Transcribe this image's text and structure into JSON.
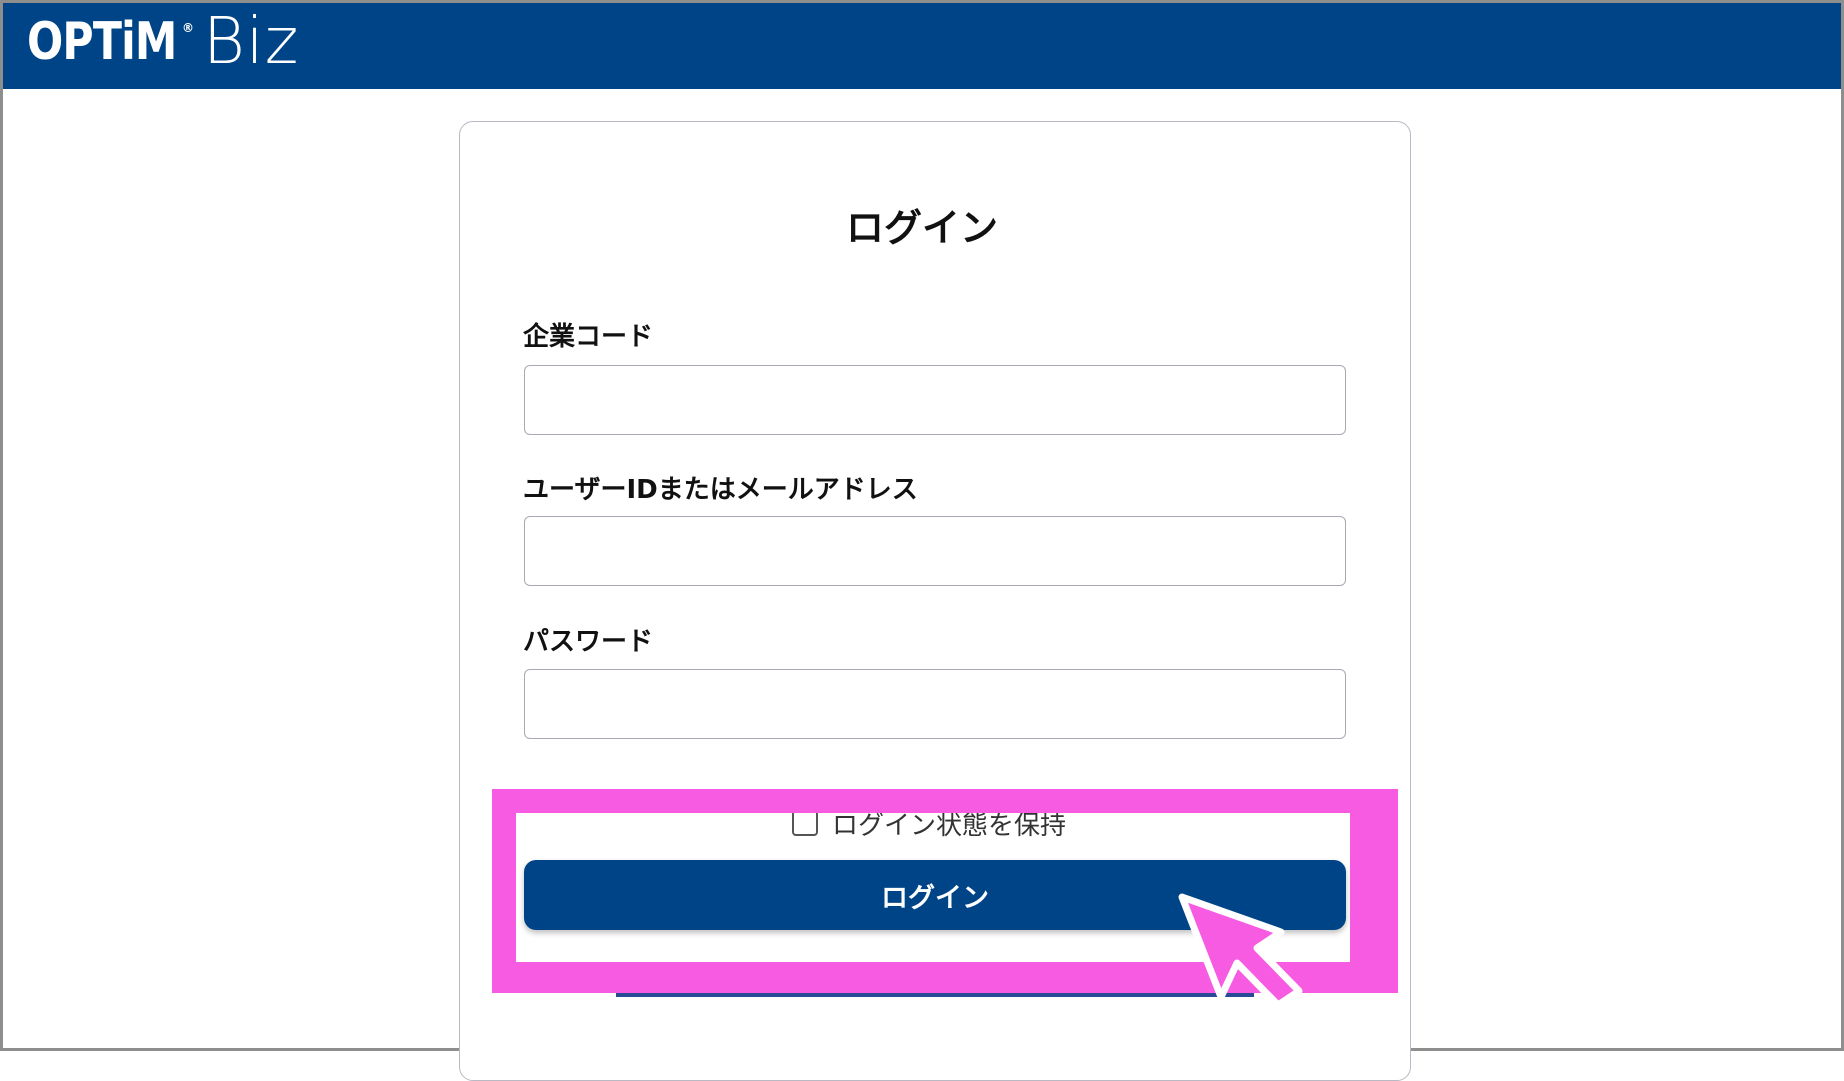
{
  "header": {
    "brand_name": "OPTiM",
    "brand_mark": "®",
    "product_name": "Biz",
    "background_color": "#004488"
  },
  "login_form": {
    "title": "ログイン",
    "fields": [
      {
        "label": "企業コード",
        "value": "",
        "placeholder": ""
      },
      {
        "label": "ユーザーIDまたはメールアドレス",
        "value": "",
        "placeholder": ""
      },
      {
        "label": "パスワード",
        "value": "",
        "placeholder": ""
      }
    ],
    "remember_label": "ログイン状態を保持",
    "remember_checked": false,
    "submit_label": "ログイン",
    "button_color": "#004488"
  },
  "annotation": {
    "highlight_color": "#f65be1",
    "cursor_icon": "pointer-arrow-icon"
  }
}
